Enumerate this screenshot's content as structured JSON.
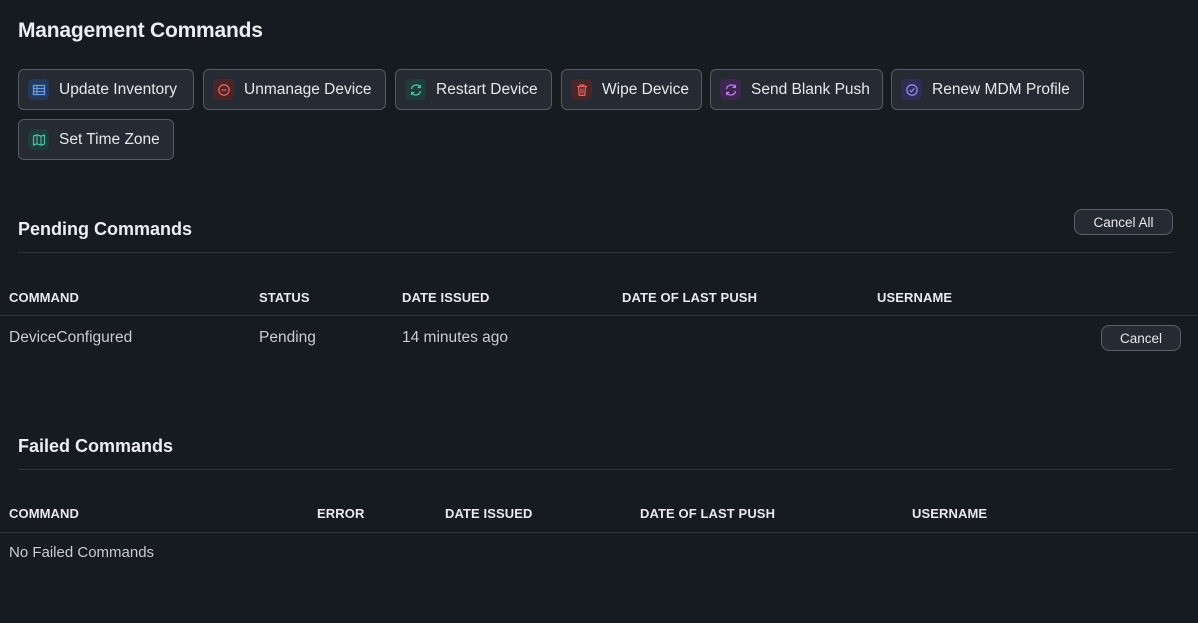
{
  "management": {
    "title": "Management Commands",
    "buttons": [
      {
        "label": "Update Inventory",
        "icon": "table-icon",
        "accent": "#5a8fe0"
      },
      {
        "label": "Unmanage Device",
        "icon": "minus-circle-icon",
        "accent": "#e0625f"
      },
      {
        "label": "Restart Device",
        "icon": "refresh-icon",
        "accent": "#4fc0a8"
      },
      {
        "label": "Wipe Device",
        "icon": "trash-icon",
        "accent": "#e0625f"
      },
      {
        "label": "Send Blank Push",
        "icon": "refresh-icon",
        "accent": "#b57ee8"
      },
      {
        "label": "Renew MDM Profile",
        "icon": "check-circle-icon",
        "accent": "#8f8be8"
      },
      {
        "label": "Set Time Zone",
        "icon": "map-icon",
        "accent": "#4fc0a8"
      }
    ]
  },
  "pending": {
    "title": "Pending Commands",
    "cancel_all_label": "Cancel All",
    "columns": [
      "COMMAND",
      "STATUS",
      "DATE ISSUED",
      "DATE OF LAST PUSH",
      "USERNAME"
    ],
    "rows": [
      {
        "command": "DeviceConfigured",
        "status": "Pending",
        "date_issued": "14 minutes ago",
        "date_last_push": "",
        "username": "",
        "action_label": "Cancel"
      }
    ]
  },
  "failed": {
    "title": "Failed Commands",
    "columns": [
      "COMMAND",
      "ERROR",
      "DATE ISSUED",
      "DATE OF LAST PUSH",
      "USERNAME"
    ],
    "empty_text": "No Failed Commands"
  },
  "colors": {
    "background": "#161a21",
    "button_bg": "#262a32",
    "button_border": "#555a63"
  }
}
